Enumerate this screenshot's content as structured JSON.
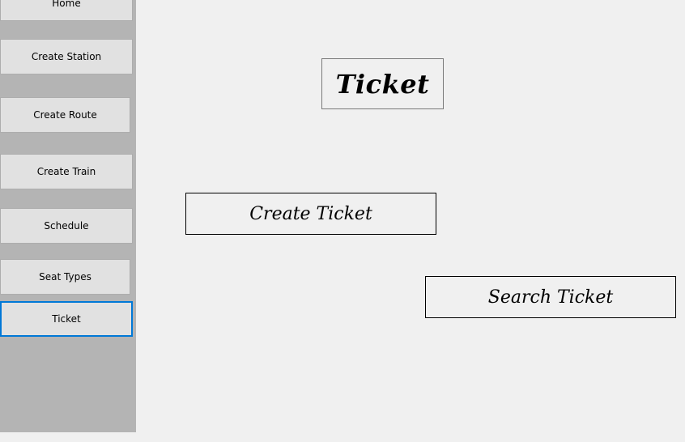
{
  "sidebar": {
    "items": [
      {
        "label": "Home"
      },
      {
        "label": "Create Station"
      },
      {
        "label": "Create Route"
      },
      {
        "label": "Create Train"
      },
      {
        "label": "Schedule"
      },
      {
        "label": "Seat Types"
      },
      {
        "label": "Ticket"
      }
    ]
  },
  "main": {
    "title": "Ticket",
    "create_ticket_label": "Create Ticket",
    "search_ticket_label": "Search Ticket"
  }
}
